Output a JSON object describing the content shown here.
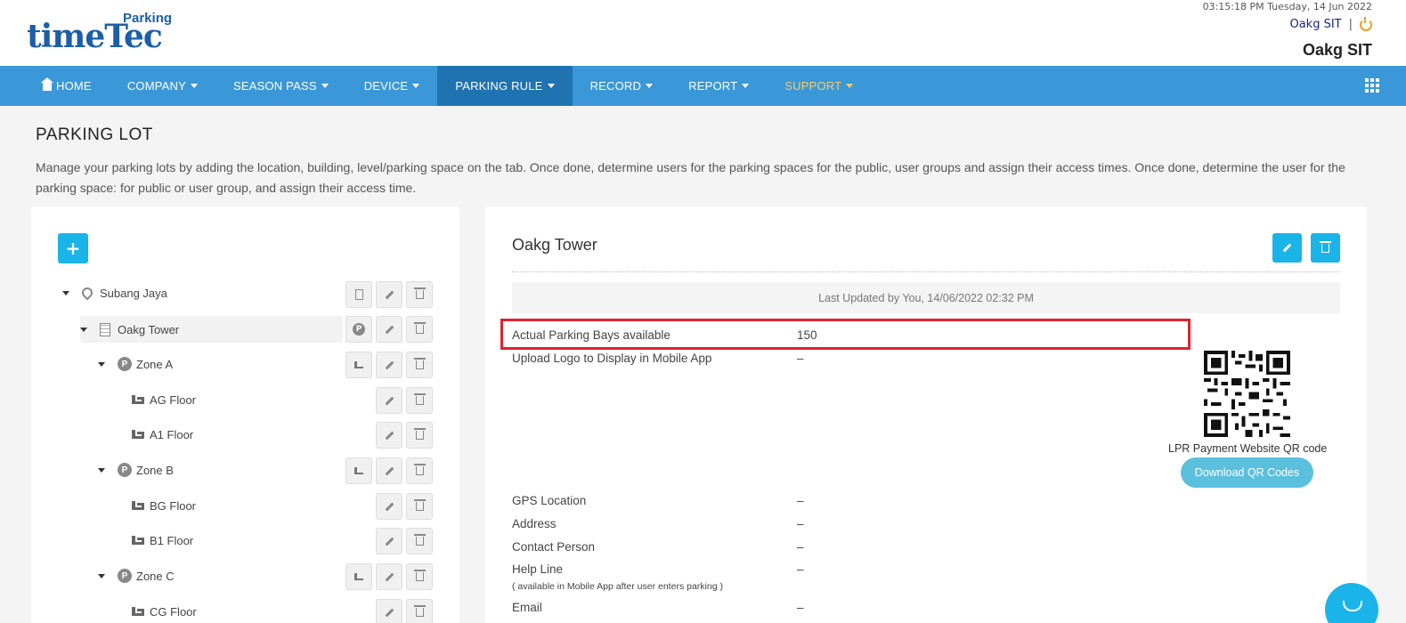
{
  "header": {
    "logo_main": "timeTec",
    "logo_sub": "Parking",
    "datetime": "03:15:18 PM Tuesday, 14 Jun 2022",
    "user": "Oakg SIT",
    "separator": "|",
    "company": "Oakg SIT"
  },
  "nav": {
    "home": "HOME",
    "company": "COMPANY",
    "season_pass": "SEASON PASS",
    "device": "DEVICE",
    "parking_rule": "PARKING RULE",
    "record": "RECORD",
    "report": "REPORT",
    "support": "SUPPORT"
  },
  "page": {
    "title": "PARKING LOT",
    "description": "Manage your parking lots by adding the location, building, level/parking space on the tab. Once done, determine users for the parking spaces for the public, user groups and assign their access times. Once done, determine the user for the parking space: for public or user group, and assign their access time."
  },
  "tree": {
    "add_label": "+",
    "p": "P",
    "items": [
      {
        "label": "Subang Jaya"
      },
      {
        "label": "Oakg Tower"
      },
      {
        "label": "Zone A"
      },
      {
        "label": "AG Floor"
      },
      {
        "label": "A1 Floor"
      },
      {
        "label": "Zone B"
      },
      {
        "label": "BG Floor"
      },
      {
        "label": "B1 Floor"
      },
      {
        "label": "Zone C"
      },
      {
        "label": "CG Floor"
      }
    ]
  },
  "detail": {
    "title": "Oakg Tower",
    "last_updated": "Last Updated by You, 14/06/2022 02:32 PM",
    "parking_bays_label": "Actual Parking Bays available",
    "parking_bays_value": "150",
    "logo_label": "Upload Logo to Display in Mobile App",
    "logo_value": "–",
    "gps_label": "GPS Location",
    "gps_value": "–",
    "address_label": "Address",
    "address_value": "–",
    "contact_label": "Contact Person",
    "contact_value": "–",
    "helpline_label": "Help Line",
    "helpline_note": "( available in Mobile App after user enters parking )",
    "helpline_value": "–",
    "email_label": "Email",
    "email_value": "–",
    "qr_label": "LPR Payment Website QR code",
    "qr_button": "Download QR Codes"
  },
  "colors": {
    "nav_bg": "#3a98d8",
    "nav_active": "#1f73b0",
    "accent": "#1ab4e8",
    "highlight": "#e0222f",
    "support": "#f7c96b"
  }
}
